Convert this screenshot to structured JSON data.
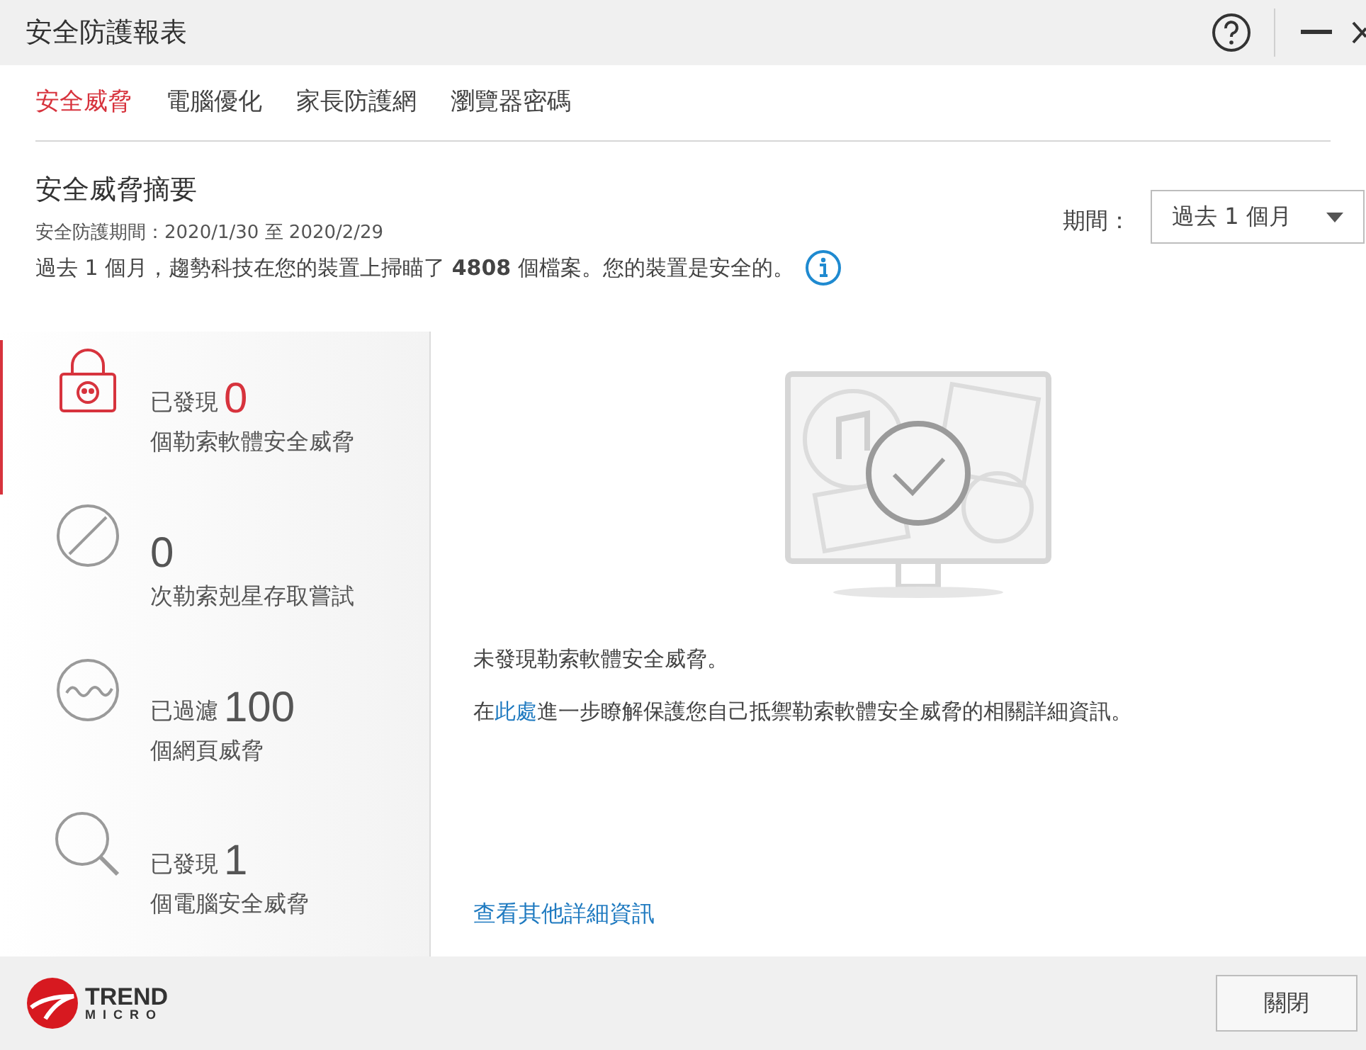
{
  "window": {
    "title": "安全防護報表"
  },
  "tabs": [
    {
      "label": "安全威脅",
      "selected": true
    },
    {
      "label": "電腦優化",
      "selected": false
    },
    {
      "label": "家長防護網",
      "selected": false
    },
    {
      "label": "瀏覽器密碼",
      "selected": false
    }
  ],
  "summary": {
    "heading": "安全威脅摘要",
    "period_range": "安全防護期間：2020/1/30 至 2020/2/29",
    "scan_text": "過去 1 個月，趨勢科技在您的裝置上掃瞄了 **4808** 個檔案。您的裝置是安全的。",
    "period_label": "期間：",
    "period_value": "過去 1 個月"
  },
  "stats": [
    {
      "kind": "lock",
      "prefix": "已發現",
      "number": "0",
      "caption": "個勒索軟體安全威脅",
      "selected": true
    },
    {
      "kind": "blocked",
      "number": "0",
      "caption": "次勒索剋星存取嘗試",
      "selected": false
    },
    {
      "kind": "wave",
      "prefix": "已過濾",
      "number": "100",
      "caption": "個網頁威脅",
      "selected": false
    },
    {
      "kind": "search",
      "prefix": "已發現",
      "number": "1",
      "caption": "個電腦安全威脅",
      "selected": false
    }
  ],
  "detail": {
    "message": "未發現勒索軟體安全威脅。",
    "learn_before": "在",
    "learn_link": "此處",
    "learn_after": "進一步瞭解保護您自己抵禦勒索軟體安全威脅的相關詳細資訊。",
    "more_link": "查看其他詳細資訊"
  },
  "footer": {
    "logo_top": "TREND",
    "logo_bottom": "MICRO",
    "close_button": "關閉"
  }
}
